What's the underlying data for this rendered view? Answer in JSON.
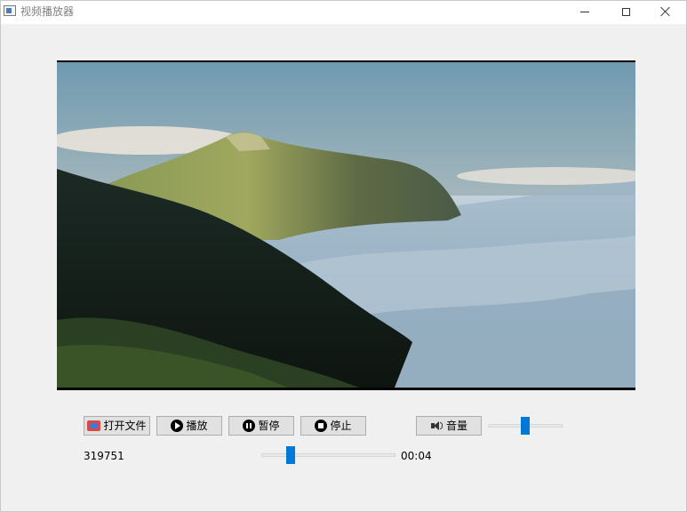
{
  "window": {
    "title": "视频播放器"
  },
  "controls": {
    "open_file_label": "打开文件",
    "play_label": "播放",
    "pause_label": "暂停",
    "stop_label": "停止",
    "volume_label": "音量"
  },
  "sliders": {
    "volume_level": 0.5,
    "progress_level": 0.2
  },
  "status": {
    "value_left": "319751",
    "time": "00:04"
  },
  "colors": {
    "accent": "#0078d7",
    "button_bg": "#e1e1e1",
    "window_bg": "#f0f0f0"
  },
  "icons": [
    "app-icon",
    "minimize-icon",
    "maximize-icon",
    "close-icon",
    "open-file-icon",
    "play-icon",
    "pause-icon",
    "stop-icon",
    "volume-icon"
  ]
}
